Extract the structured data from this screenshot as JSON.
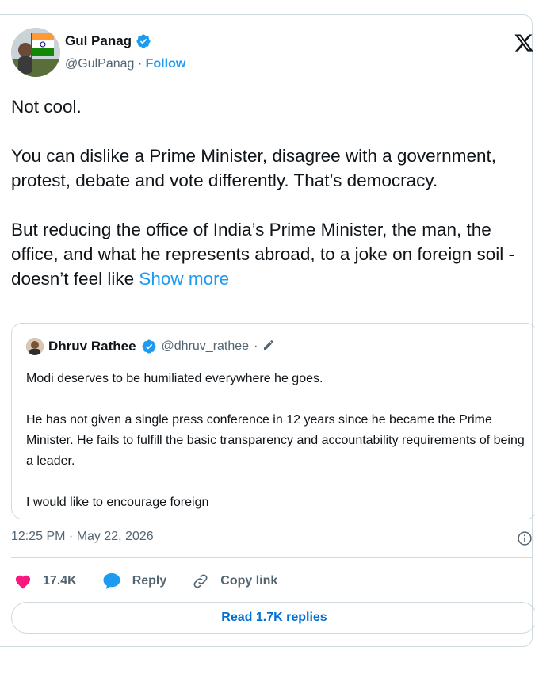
{
  "author": {
    "name": "Gul Panag",
    "handle": "@GulPanag",
    "separator": " · ",
    "follow_label": "Follow"
  },
  "tweet": {
    "paragraphs": [
      "Not cool.",
      "You can dislike a Prime Minister, disagree with a government, protest, debate and vote differently. That’s democracy.",
      "But reducing the office of India’s Prime Minister, the man, the office, and what he represents abroad, to a joke on foreign soil -doesn’t feel like "
    ],
    "show_more": "Show more"
  },
  "quote": {
    "name": "Dhruv Rathee",
    "handle": "@dhruv_rathee",
    "separator": "·",
    "paragraphs": [
      "Modi deserves to be humiliated everywhere he goes.",
      "He has not given a single press conference in 12 years since he became the Prime Minister. He fails to fulfill the basic transparency and accountability requirements of being a leader.",
      "I would like to encourage foreign"
    ]
  },
  "timestamp": "12:25 PM · May 22, 2026",
  "actions": {
    "likes": "17.4K",
    "reply": "Reply",
    "copy_link": "Copy link"
  },
  "read_replies": "Read 1.7K replies",
  "icons": {
    "verified": "verified-badge-icon",
    "x_logo": "x-logo-icon",
    "heart": "heart-icon",
    "reply": "reply-bubble-icon",
    "link": "link-icon",
    "info": "info-icon",
    "pencil": "pencil-icon"
  },
  "colors": {
    "accent": "#1d9bf0",
    "like": "#f91880",
    "reply_link": "#006fd6",
    "muted": "#536471",
    "border": "#cfd9de",
    "text": "#0f1419"
  }
}
